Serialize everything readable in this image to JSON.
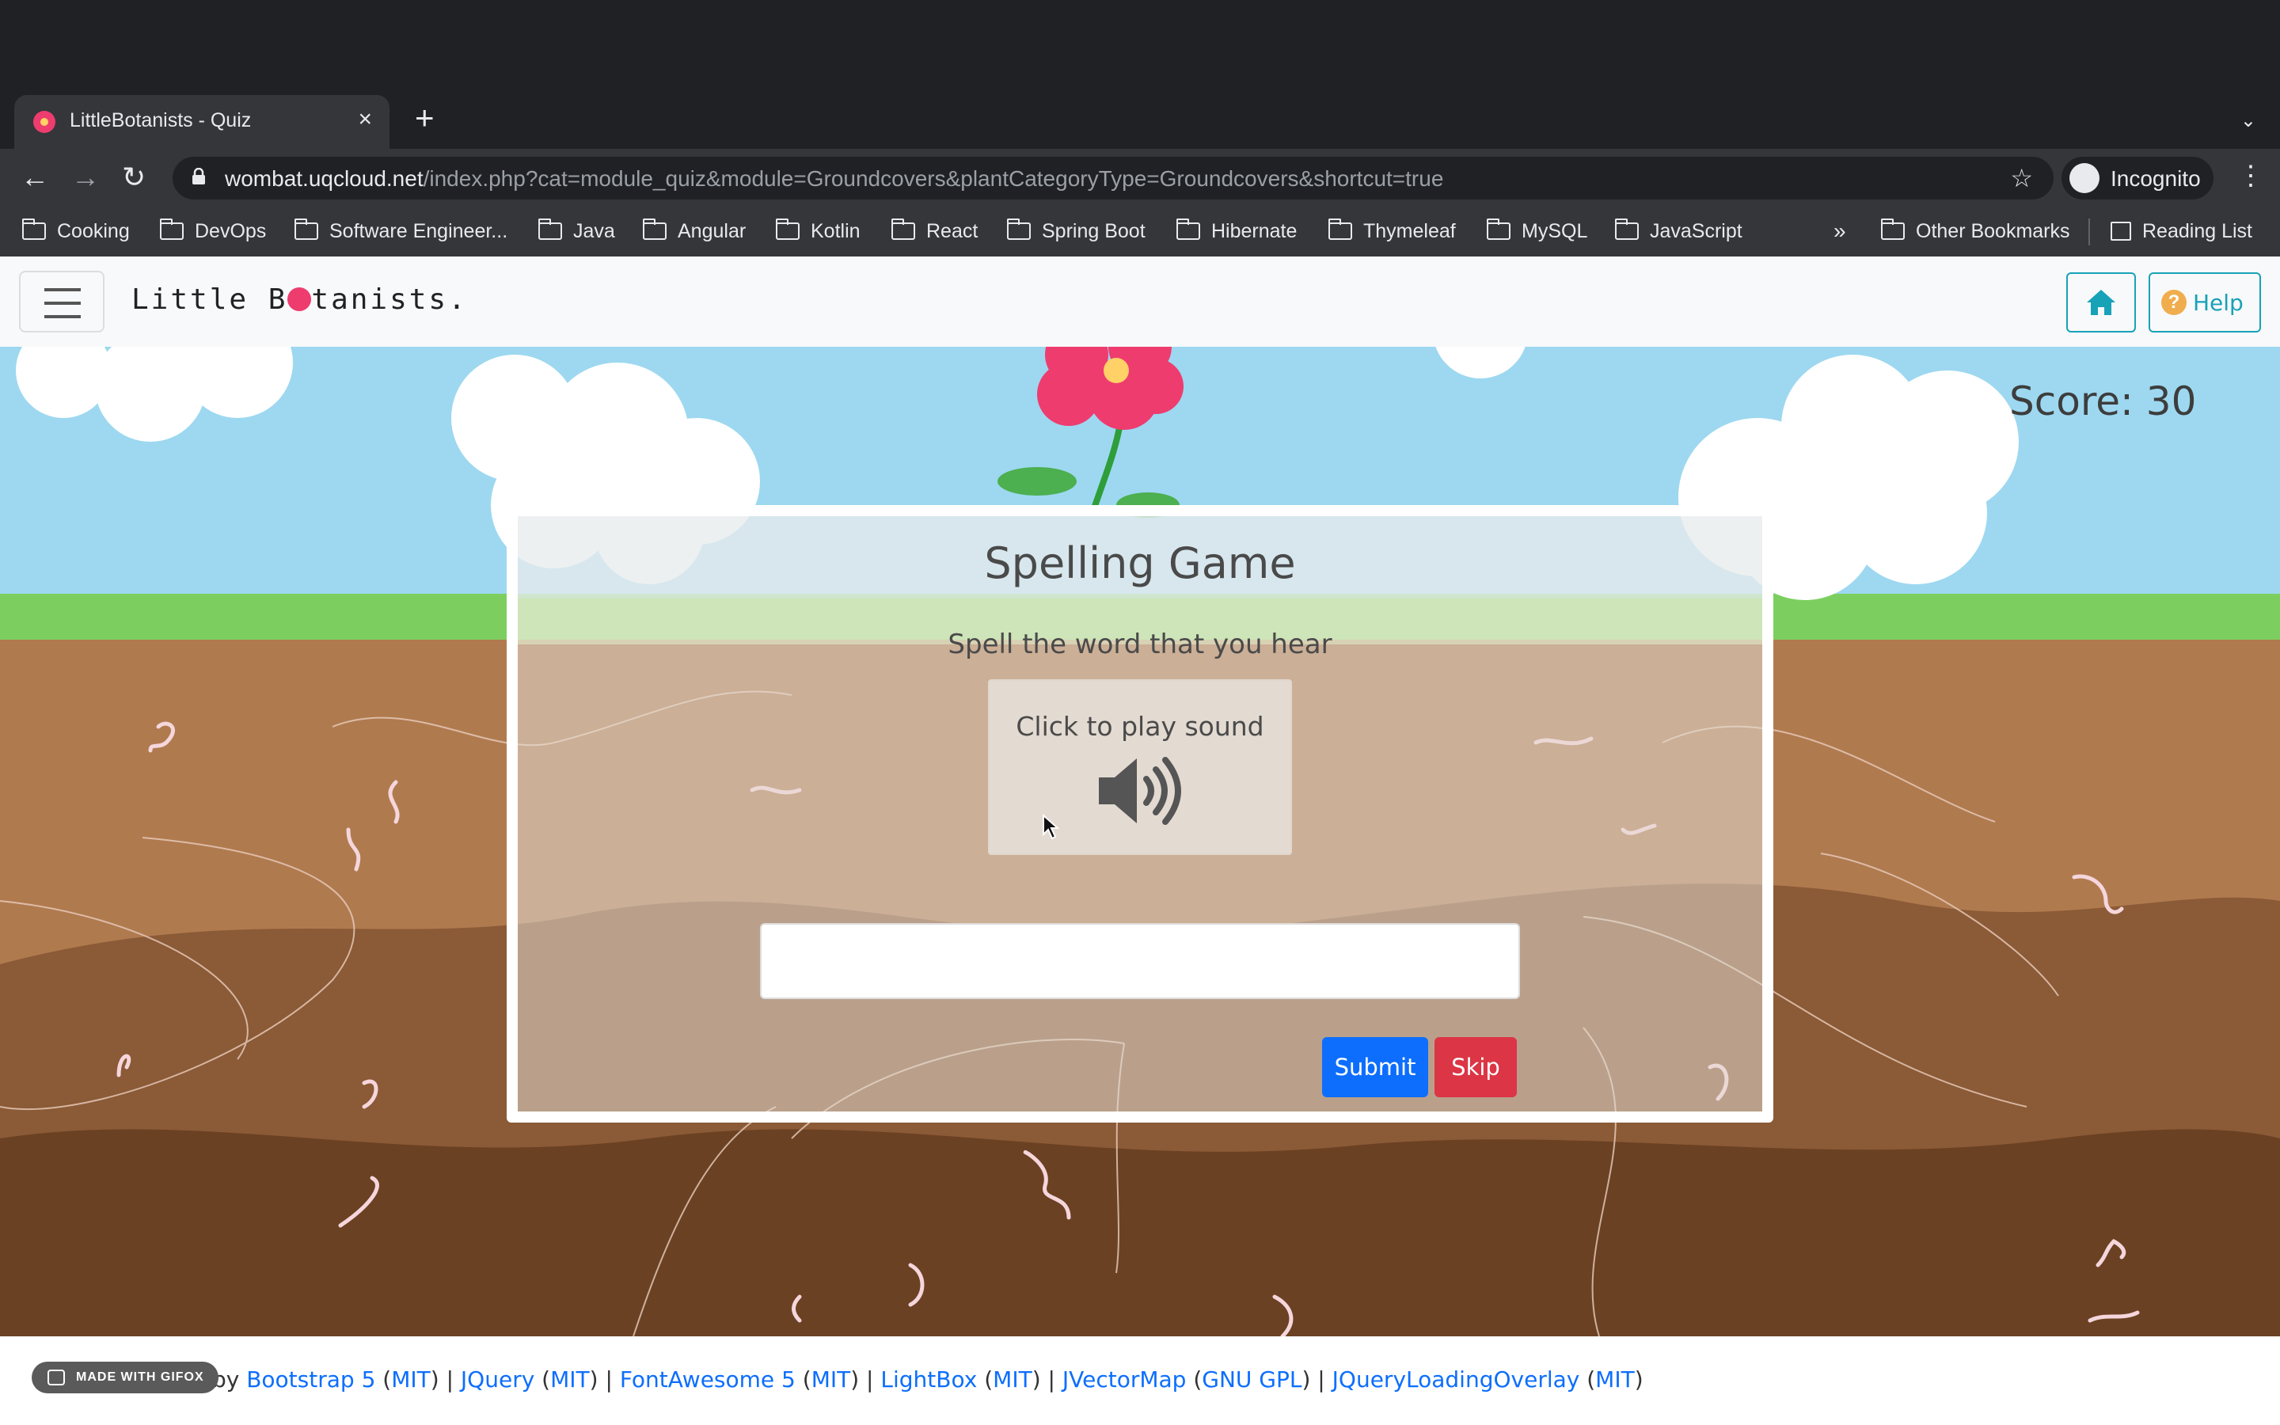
{
  "browser": {
    "tab_title": "LittleBotanists - Quiz",
    "new_tab_symbol": "+",
    "url_host": "wombat.uqcloud.net",
    "url_path": "/index.php?cat=module_quiz&module=Groundcovers&plantCategoryType=Groundcovers&shortcut=true",
    "profile_label": "Incognito",
    "bookmarks": [
      "Cooking",
      "DevOps",
      "Software Engineer...",
      "Java",
      "Angular",
      "Kotlin",
      "React",
      "Spring Boot",
      "Hibernate",
      "Thymeleaf",
      "MySQL",
      "JavaScript"
    ],
    "bookmarks_overflow": "»",
    "other_bookmarks": "Other Bookmarks",
    "reading_list": "Reading List"
  },
  "navbar": {
    "brand_pre": "Little B",
    "brand_post": "tanists.",
    "help_label": "Help",
    "home_icon": "home-icon",
    "help_icon": "question-circle-icon"
  },
  "game": {
    "score_text": "Score: 30",
    "title": "Spelling Game",
    "instruction": "Spell the word that you hear",
    "sound_label": "Click to play sound",
    "answer_value": "",
    "submit_label": "Submit",
    "skip_label": "Skip"
  },
  "footer": {
    "badge": "MADE WITH GIFOX",
    "powered_prefix": "Powered by",
    "libraries": [
      {
        "name": "Bootstrap 5",
        "license": "MIT"
      },
      {
        "name": "JQuery",
        "license": "MIT"
      },
      {
        "name": "FontAwesome 5",
        "license": "MIT"
      },
      {
        "name": "LightBox",
        "license": "MIT"
      },
      {
        "name": "JVectorMap",
        "license": "GNU GPL"
      },
      {
        "name": "JQueryLoadingOverlay",
        "license": "MIT"
      }
    ]
  },
  "colors": {
    "sky": "#9dd8f0",
    "grass": "#7ccf5f",
    "soil_light": "#b07a4f",
    "soil_mid": "#8b5a36",
    "soil_dark": "#6b4123",
    "submit": "#0d6efd",
    "skip": "#dc3545",
    "accent_info": "#17a2b8"
  }
}
